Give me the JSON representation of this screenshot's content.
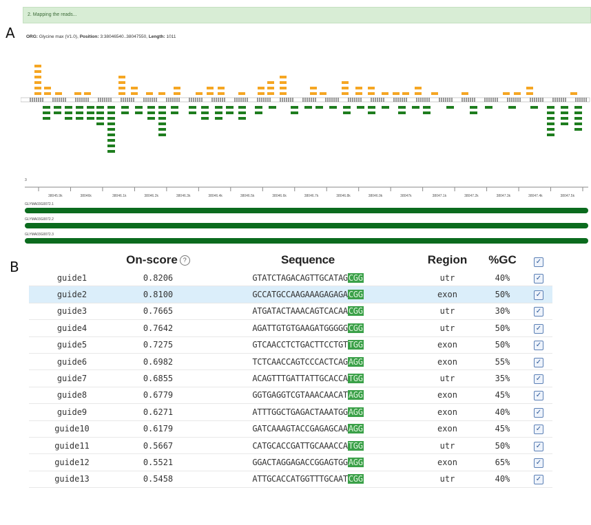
{
  "panels": {
    "a": "A",
    "b": "B"
  },
  "status": {
    "text": "2. Mapping the reads..."
  },
  "org": {
    "org_label": "ORG:",
    "org_value": "Glycine max (V1.0),",
    "position_label": "Position:",
    "position_value": "3:38046540..38047550,",
    "length_label": "Length:",
    "length_value": "1011"
  },
  "axis": {
    "start_tick": "3",
    "ticks": [
      "38045.9k",
      "38046k",
      "38046.1k",
      "38046.2k",
      "38046.3k",
      "38046.4k",
      "38046.5k",
      "38046.6k",
      "38046.7k",
      "38046.8k",
      "38046.9k",
      "38047k",
      "38047.1k",
      "38047.2k",
      "38047.3k",
      "38047.4k",
      "38047.5k",
      "38047.6k"
    ]
  },
  "transcripts": [
    "GLYMA03G0072.1",
    "GLYMA03G0072.2",
    "GLYMA03G0072.3"
  ],
  "table": {
    "headers": {
      "on_score": "On-score",
      "sequence": "Sequence",
      "region": "Region",
      "gc": "%GC",
      "help_icon": "?"
    },
    "rows": [
      {
        "name": "guide1",
        "score": "0.8206",
        "seq": "GTATCTAGACAGTTGCATAG",
        "pam": "CGG",
        "region": "utr",
        "gc": "40%"
      },
      {
        "name": "guide2",
        "score": "0.8100",
        "seq": "GCCATGCCAAGAAAGAGAGA",
        "pam": "CGG",
        "region": "exon",
        "gc": "50%"
      },
      {
        "name": "guide3",
        "score": "0.7665",
        "seq": "ATGATACTAAACAGTCACAA",
        "pam": "CGG",
        "region": "utr",
        "gc": "30%"
      },
      {
        "name": "guide4",
        "score": "0.7642",
        "seq": "AGATTGTGTGAAGATGGGGG",
        "pam": "CGG",
        "region": "utr",
        "gc": "50%"
      },
      {
        "name": "guide5",
        "score": "0.7275",
        "seq": "GTCAACCTCTGACTTCCTGT",
        "pam": "TGG",
        "region": "exon",
        "gc": "50%"
      },
      {
        "name": "guide6",
        "score": "0.6982",
        "seq": "TCTCAACCAGTCCCACTCAG",
        "pam": "AGG",
        "region": "exon",
        "gc": "55%"
      },
      {
        "name": "guide7",
        "score": "0.6855",
        "seq": "ACAGTTTGATTATTGCACCA",
        "pam": "TGG",
        "region": "utr",
        "gc": "35%"
      },
      {
        "name": "guide8",
        "score": "0.6779",
        "seq": "GGTGAGGTCGTAAACAACAT",
        "pam": "AGG",
        "region": "exon",
        "gc": "45%"
      },
      {
        "name": "guide9",
        "score": "0.6271",
        "seq": "ATTTGGCTGAGACTAAATGG",
        "pam": "AGG",
        "region": "exon",
        "gc": "40%"
      },
      {
        "name": "guide10",
        "score": "0.6179",
        "seq": "GATCAAAGTACCGAGAGCAA",
        "pam": "AGG",
        "region": "exon",
        "gc": "45%"
      },
      {
        "name": "guide11",
        "score": "0.5667",
        "seq": "CATGCACCGATTGCAAACCA",
        "pam": "TGG",
        "region": "utr",
        "gc": "50%"
      },
      {
        "name": "guide12",
        "score": "0.5521",
        "seq": "GGACTAGGAGACCGGAGTGG",
        "pam": "AGG",
        "region": "exon",
        "gc": "65%"
      },
      {
        "name": "guide13",
        "score": "0.5458",
        "seq": "ATTGCACCATGGTTTGCAAT",
        "pam": "CGG",
        "region": "utr",
        "gc": "40%"
      }
    ],
    "selected_row": "guide2"
  },
  "colors": {
    "forward_reads": "#f5a623",
    "reverse_reads": "#1e7d1e",
    "transcript": "#0b6b1e",
    "pam_highlight": "#3aa048",
    "selection": "#dbeefa"
  }
}
